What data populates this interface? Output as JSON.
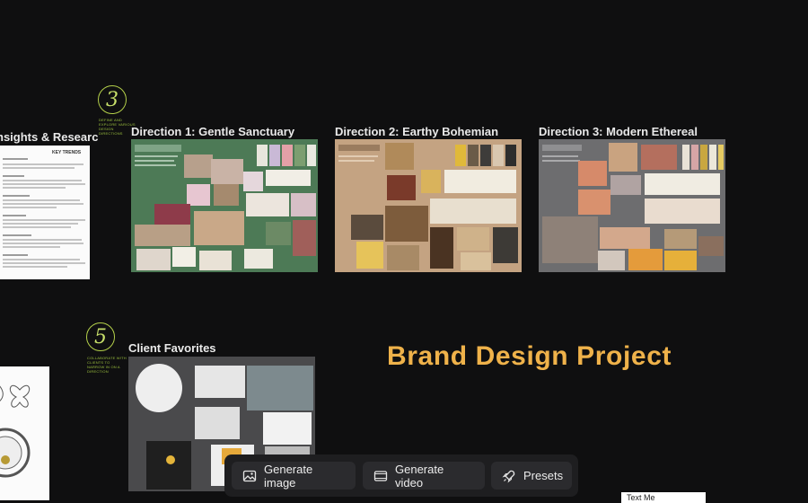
{
  "steps": [
    {
      "number": "3",
      "caption": "DEFINE AND EXPLORE VARIOUS DESIGN DIRECTIONS"
    },
    {
      "number": "5",
      "caption": "COLLABORATE WITH CLIENTS TO NARROW IN ON A DIRECTION"
    }
  ],
  "frames": {
    "insights": {
      "title": "nsights & Researc",
      "doc_heading": "KEY TRENDS"
    },
    "direction1": {
      "title": "Direction 1: Gentle Sanctuary",
      "bg": "#4d7a56",
      "swatches": [
        "#e8e6dc",
        "#c9b9d6",
        "#e3a0a7",
        "#7c9e70",
        "#e9e9e0"
      ]
    },
    "direction2": {
      "title": "Direction 2: Earthy Bohemian",
      "bg": "#c4a382",
      "swatches": [
        "#e0b93a",
        "#6a5b48",
        "#3e3c3a",
        "#d9c7b0",
        "#2d2d2d"
      ]
    },
    "direction3": {
      "title": "Direction 3: Modern Ethereal",
      "bg": "#6d6d6f",
      "swatches": [
        "#e9e2d6",
        "#d6a5a6",
        "#c9a740",
        "#ece8da",
        "#e5ca62"
      ]
    },
    "favorites": {
      "title": "Client Favorites",
      "bg": "#4a4a4c"
    }
  },
  "brand_title": "Brand Design Project",
  "toolbar": {
    "generate_image": "Generate image",
    "generate_video": "Generate video",
    "presets": "Presets"
  },
  "tooltip": "Text Me"
}
